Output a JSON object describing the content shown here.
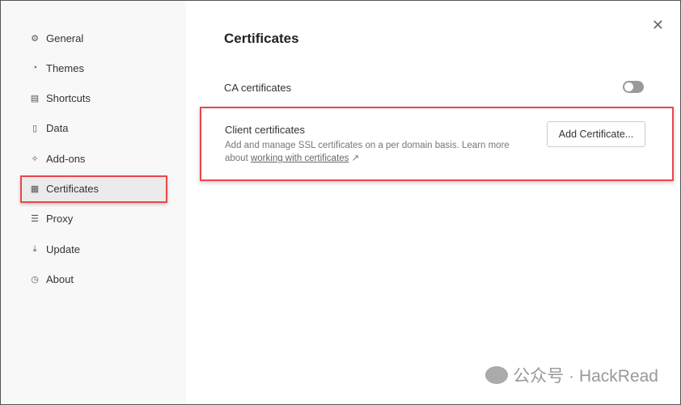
{
  "sidebar": {
    "items": [
      {
        "label": "General",
        "icon": "gear-icon",
        "glyph": "⚙"
      },
      {
        "label": "Themes",
        "icon": "palette-icon",
        "glyph": "◔"
      },
      {
        "label": "Shortcuts",
        "icon": "keyboard-icon",
        "glyph": "▤"
      },
      {
        "label": "Data",
        "icon": "data-icon",
        "glyph": "▯"
      },
      {
        "label": "Add-ons",
        "icon": "sparkle-icon",
        "glyph": "✧"
      },
      {
        "label": "Certificates",
        "icon": "certificate-icon",
        "glyph": "▦",
        "active": true
      },
      {
        "label": "Proxy",
        "icon": "server-icon",
        "glyph": "☰"
      },
      {
        "label": "Update",
        "icon": "download-icon",
        "glyph": "⤓"
      },
      {
        "label": "About",
        "icon": "info-icon",
        "glyph": "◷"
      }
    ]
  },
  "main": {
    "title": "Certificates",
    "close_glyph": "✕",
    "ca": {
      "label": "CA certificates",
      "enabled": false
    },
    "client": {
      "title": "Client certificates",
      "desc": "Add and manage SSL certificates on a per domain basis. Learn more about ",
      "link": "working with certificates",
      "link_arrow": "↗",
      "button": "Add Certificate..."
    }
  },
  "watermark": "公众号 · HackRead",
  "colors": {
    "highlight": "#e8474b",
    "sidebar_bg": "#f8f8f8"
  }
}
